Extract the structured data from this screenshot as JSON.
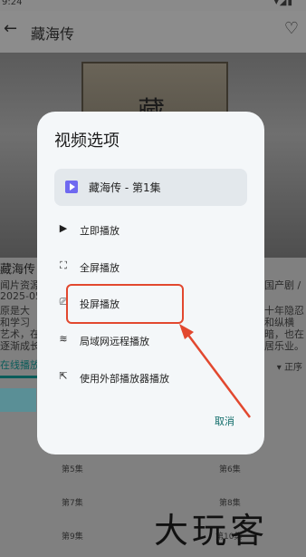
{
  "status_bar": {
    "time": "9:24",
    "icons": "▾◢▮"
  },
  "app_bar": {
    "title": "藏海传",
    "back_icon": "arrow-left-icon",
    "favorite_icon": "heart-outline-icon"
  },
  "hero": {
    "glyph": "藏"
  },
  "background": {
    "title": "藏海传",
    "lines": [
      "闻片资源",
      "2025-05",
      "原是大",
      "和学习",
      "艺术，在",
      "逐渐成长"
    ],
    "right_lines": [
      "国产剧 /",
      "十年隐忍",
      "和纵横",
      "暗，也在",
      "居乐业。"
    ],
    "tab": "在线播放",
    "sort": "▾ 正序",
    "episodes": [
      "第5集",
      "第6集",
      "第7集",
      "第8集",
      "第9集",
      "第10集"
    ]
  },
  "dialog": {
    "title": "视频选项",
    "video_title": "藏海传 - 第1集",
    "options": [
      {
        "label": "立即播放",
        "icon": "play-icon",
        "glyph": "▶"
      },
      {
        "label": "全屏播放",
        "icon": "fullscreen-icon",
        "glyph": "⛶"
      },
      {
        "label": "投屏播放",
        "icon": "cast-icon",
        "glyph": "⎚"
      },
      {
        "label": "局域网远程播放",
        "icon": "wifi-icon",
        "glyph": "≋"
      },
      {
        "label": "使用外部播放器播放",
        "icon": "open-external-icon",
        "glyph": "⇱"
      }
    ],
    "cancel_label": "取消"
  },
  "watermark": "大玩客",
  "colors": {
    "accent": "#0e6b69",
    "highlight": "#e2482f",
    "play_badge": "#6f69f0"
  }
}
